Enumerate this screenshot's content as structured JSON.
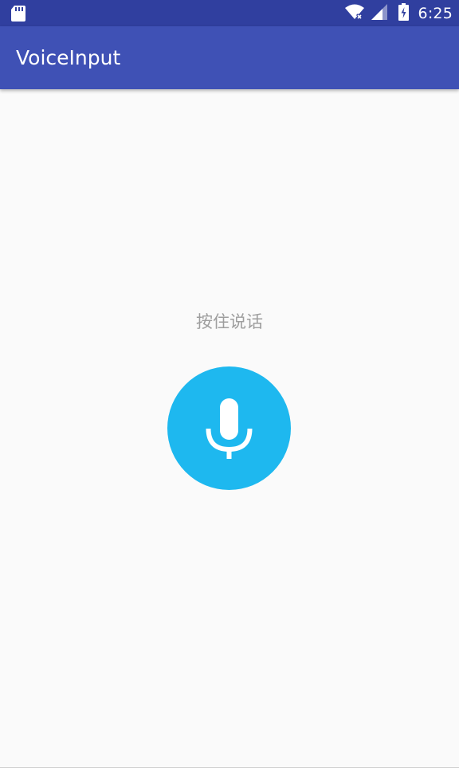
{
  "status_bar": {
    "time": "6:25",
    "icons": [
      "sd-card-icon",
      "wifi-icon",
      "signal-icon",
      "battery-charging-icon"
    ]
  },
  "app_bar": {
    "title": "VoiceInput",
    "color": "#3f51b5",
    "status_color": "#303f9f"
  },
  "main": {
    "hint": "按住说话",
    "mic_button": {
      "icon": "microphone-icon",
      "color": "#1eb8ef"
    }
  }
}
